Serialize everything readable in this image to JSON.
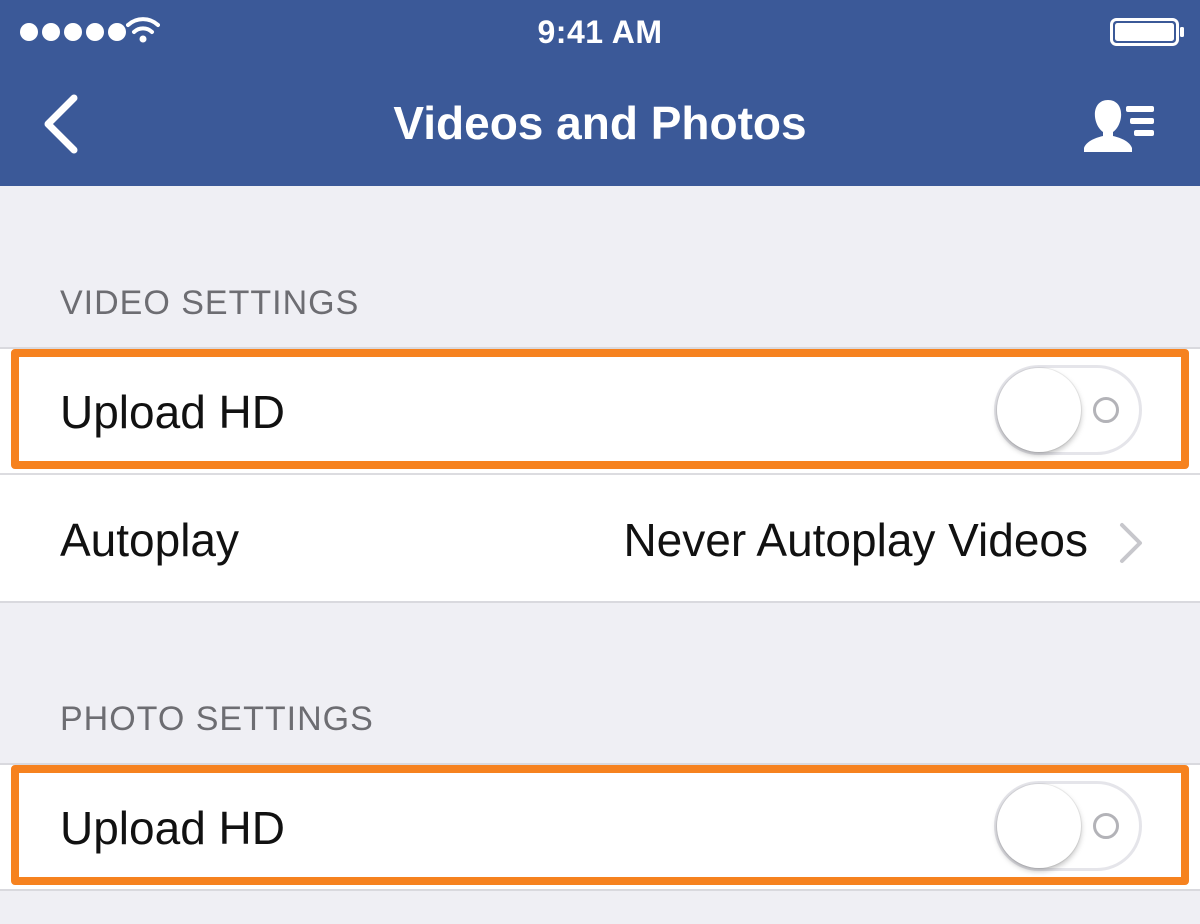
{
  "status_bar": {
    "signal_strength": 5,
    "time": "9:41 AM",
    "icons": [
      "signal-dots-icon",
      "wifi-icon",
      "battery-icon"
    ]
  },
  "nav_bar": {
    "title": "Videos and Photos",
    "back_icon": "chevron-left-icon",
    "right_icon": "friends-list-icon"
  },
  "video_settings": {
    "header": "VIDEO SETTINGS",
    "upload_hd": {
      "label": "Upload HD",
      "enabled": false
    },
    "autoplay": {
      "label": "Autoplay",
      "value": "Never Autoplay Videos"
    }
  },
  "photo_settings": {
    "header": "PHOTO SETTINGS",
    "upload_hd": {
      "label": "Upload HD",
      "enabled": false
    }
  },
  "colors": {
    "nav_background": "#3b5998",
    "page_background": "#efeff4",
    "highlight": "#f6821f",
    "section_text": "#6d6d72"
  }
}
